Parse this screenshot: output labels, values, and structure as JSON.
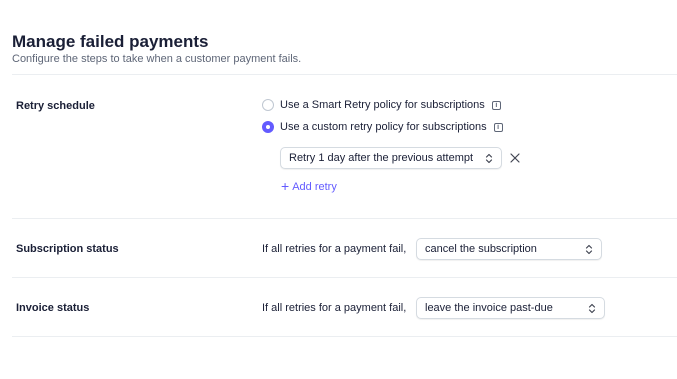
{
  "header": {
    "title": "Manage failed payments",
    "subtitle": "Configure the steps to take when a customer payment fails."
  },
  "retry_schedule": {
    "label": "Retry schedule",
    "options": [
      {
        "label": "Use a Smart Retry policy for subscriptions",
        "selected": false
      },
      {
        "label": "Use a custom retry policy for subscriptions",
        "selected": true
      }
    ],
    "retry_select_value": "Retry 1 day after the previous attempt",
    "add_retry_label": "Add retry"
  },
  "subscription_status": {
    "label": "Subscription status",
    "prefix": "If all retries for a payment fail,",
    "select_value": "cancel the subscription"
  },
  "invoice_status": {
    "label": "Invoice status",
    "prefix": "If all retries for a payment fail,",
    "select_value": "leave the invoice past-due"
  },
  "colors": {
    "accent": "#635bff",
    "text": "#1a1f36",
    "muted": "#5e6677",
    "divider": "#ebeef1"
  },
  "icons": [
    "info-icon",
    "chevron-updown-icon",
    "close-icon",
    "plus-icon"
  ]
}
